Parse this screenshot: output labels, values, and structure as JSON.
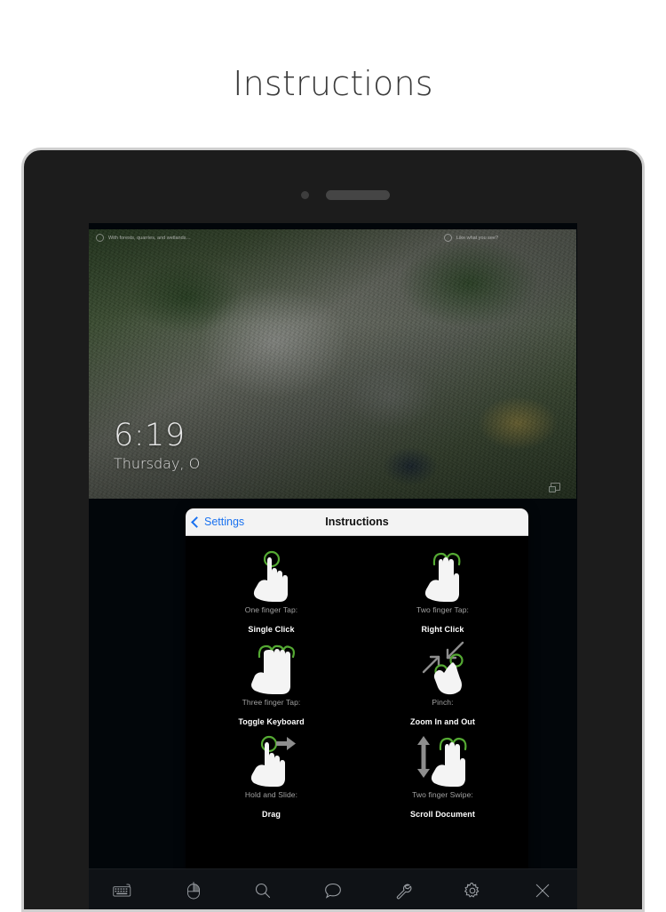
{
  "page": {
    "title": "Instructions"
  },
  "device": {
    "camera_icon": "camera-dot",
    "speaker_icon": "speaker-grille"
  },
  "remote_desktop": {
    "spotlight_left_text": "With forests, quarries, and wetlands…",
    "spotlight_right_text": "Like what you see?",
    "lock_time": "6:19",
    "lock_date": "Thursday, O",
    "corner_icon": "display-icon"
  },
  "modal": {
    "back_label": "Settings",
    "title": "Instructions",
    "gestures": [
      {
        "icon": "one-finger-tap-hand-icon",
        "caption": "One finger Tap:",
        "action": "Single Click"
      },
      {
        "icon": "two-finger-tap-hand-icon",
        "caption": "Two finger Tap:",
        "action": "Right Click"
      },
      {
        "icon": "three-finger-tap-hand-icon",
        "caption": "Three finger Tap:",
        "action": "Toggle Keyboard"
      },
      {
        "icon": "pinch-hand-icon",
        "caption": "Pinch:",
        "action": "Zoom In and Out"
      },
      {
        "icon": "hold-and-slide-hand-icon",
        "caption": "Hold and Slide:",
        "action": "Drag"
      },
      {
        "icon": "two-finger-swipe-hand-icon",
        "caption": "Two finger Swipe:",
        "action": "Scroll Document"
      }
    ]
  },
  "toolbar": {
    "items": [
      {
        "icon": "keyboard-icon",
        "label": "Keyboard"
      },
      {
        "icon": "mouse-icon",
        "label": "Mouse"
      },
      {
        "icon": "search-icon",
        "label": "Search"
      },
      {
        "icon": "chat-bubble-icon",
        "label": "Chat"
      },
      {
        "icon": "wrench-icon",
        "label": "Tools"
      },
      {
        "icon": "gear-icon",
        "label": "Settings"
      },
      {
        "icon": "close-icon",
        "label": "Close"
      }
    ]
  },
  "colors": {
    "accent_blue": "#1a72f0",
    "gesture_green": "#55aa33",
    "hand_white": "#f4f4f4",
    "modal_black": "#000000",
    "bezel": "#1c1c1c"
  }
}
